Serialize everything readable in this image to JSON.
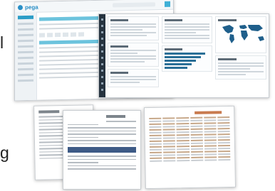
{
  "edge_letters": {
    "top": "l",
    "bottom": "g"
  },
  "app": {
    "brand": "pega",
    "colors": {
      "accent": "#2a8fc6",
      "nav_active": "#2c9dc7",
      "dark_rail": "#26333f",
      "bar": "#2a6f97"
    }
  },
  "icons": [
    "logo-icon",
    "search-icon",
    "world-map-icon"
  ]
}
